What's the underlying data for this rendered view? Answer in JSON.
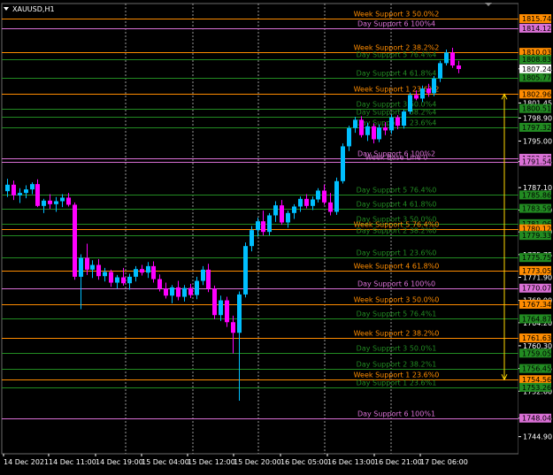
{
  "window": {
    "symbol_title": "XAUUSD,H1"
  },
  "colors": {
    "background": "#000000",
    "bull": "#00bfff",
    "bear": "#ff00ff",
    "orange_line": "#ff8c00",
    "violet_line": "#da70d6",
    "green_line": "#228b22",
    "axis_text": "#ffffff",
    "price_axis_bg": "#000000",
    "current_price_bg": "#ffffff",
    "range_marker": "#ffd700"
  },
  "chart_data": {
    "type": "candlestick",
    "timeframe": "H1",
    "ylim": [
      1742.0,
      1818.3
    ],
    "price_ticks": [
      "1807.24",
      "1801.45",
      "1798.90",
      "1795.00",
      "1791.54",
      "1787.10",
      "1783.30",
      "1779.60",
      "1775.75",
      "1771.90",
      "1768.00",
      "1764.20",
      "1760.30",
      "1756.45",
      "1752.60",
      "1748.04",
      "1744.90"
    ],
    "time_labels": [
      "14 Dec 2021",
      "14 Dec 11:00",
      "14 Dec 19:00",
      "15 Dec 04:00",
      "15 Dec 12:00",
      "15 Dec 20:00",
      "16 Dec 05:00",
      "16 Dec 13:00",
      "16 Dec 21:00",
      "17 Dec 06:00"
    ],
    "vertical_separators": [
      "14 Dec 11:00",
      "15 Dec 04:00",
      "15 Dec 20:00",
      "16 Dec 13:00",
      "17 Dec 06:00"
    ],
    "current_price": "1807.24",
    "range_marker": {
      "from": 1802.96,
      "to": 1754.56
    },
    "levels": [
      {
        "price": 1815.74,
        "label": "Week Support 3 50.0%2",
        "color": "orange",
        "tag": "1815.74"
      },
      {
        "price": 1814.12,
        "label": "Day Support 6 100%4",
        "color": "violet",
        "tag": "1814.12"
      },
      {
        "price": 1810.03,
        "label": "Week Support 2 38.2%2",
        "color": "orange",
        "tag": "1810.03"
      },
      {
        "price": 1808.83,
        "label": "Day Support 5 76.4%4",
        "color": "green",
        "tag": "1808.83"
      },
      {
        "price": 1805.77,
        "label": "Day Support 4 61.8%4",
        "color": "green",
        "tag": "1805.77"
      },
      {
        "price": 1802.96,
        "label": "Week Support 1 23.6%2",
        "color": "orange",
        "tag": "1802.96"
      },
      {
        "price": 1800.51,
        "label": "Day Support 3 50.0%4",
        "color": "green",
        "tag": "1800.51"
      },
      {
        "price": 1799.1,
        "label": "Day Support 2 38.2%4",
        "color": "green",
        "tag": ""
      },
      {
        "price": 1797.32,
        "label": "Day Support 1 23.6%4",
        "color": "green",
        "tag": "1797.32"
      },
      {
        "price": 1792.08,
        "label": "Day Support 6 100%2",
        "color": "violet",
        "tag": "1792.08"
      },
      {
        "price": 1791.54,
        "label": "Week Base Line 0",
        "color": "violet",
        "tag": "1791.54"
      },
      {
        "price": 1785.86,
        "label": "Day Support 5 76.4%0",
        "color": "green",
        "tag": "1785.86"
      },
      {
        "price": 1783.59,
        "label": "Day Support 4 61.8%0",
        "color": "green",
        "tag": "1783.59"
      },
      {
        "price": 1781.0,
        "label": "Day Support 3 50.0%0",
        "color": "green",
        "tag": "1781.06"
      },
      {
        "price": 1780.12,
        "label": "Week Support 5 76.4%0",
        "color": "orange",
        "tag": "1780.12"
      },
      {
        "price": 1779.0,
        "label": "Day Support 2 38.2%0",
        "color": "green",
        "tag": "1779.33"
      },
      {
        "price": 1775.25,
        "label": "Day Support 1 23.6%0",
        "color": "green",
        "tag": "1775.75"
      },
      {
        "price": 1773.05,
        "label": "Week Support 4 61.8%0",
        "color": "orange",
        "tag": "1773.05"
      },
      {
        "price": 1770.07,
        "label": "Day Support 6 100%0",
        "color": "violet",
        "tag": "1770.07"
      },
      {
        "price": 1767.34,
        "label": "Week Support 3 50.0%0",
        "color": "orange",
        "tag": "1767.34"
      },
      {
        "price": 1764.87,
        "label": "Day Support 5 76.4%1",
        "color": "green",
        "tag": "1764.87"
      },
      {
        "price": 1761.63,
        "label": "Week Support 2 38.2%0",
        "color": "orange",
        "tag": "1761.63"
      },
      {
        "price": 1759.05,
        "label": "Day Support 3 50.0%1",
        "color": "green",
        "tag": "1759.05"
      },
      {
        "price": 1756.45,
        "label": "Day Support 2 38.2%1",
        "color": "green",
        "tag": "1756.45"
      },
      {
        "price": 1754.56,
        "label": "Week Support 1 23.6%0",
        "color": "orange",
        "tag": "1754.56"
      },
      {
        "price": 1753.26,
        "label": "Day Support 1 23.6%1",
        "color": "green",
        "tag": "1753.26"
      },
      {
        "price": 1748.04,
        "label": "Day Support 6 100%1",
        "color": "violet",
        "tag": "1748.04"
      }
    ],
    "candles": [
      [
        1786.5,
        1788.6,
        1785.5,
        1787.6
      ],
      [
        1787.6,
        1788.3,
        1785.0,
        1785.8
      ],
      [
        1785.8,
        1787.0,
        1784.5,
        1786.2
      ],
      [
        1786.2,
        1787.5,
        1785.3,
        1786.8
      ],
      [
        1786.8,
        1788.0,
        1786.0,
        1787.7
      ],
      [
        1787.7,
        1788.5,
        1783.8,
        1784.0
      ],
      [
        1784.0,
        1785.2,
        1782.8,
        1784.9
      ],
      [
        1784.9,
        1786.0,
        1783.5,
        1784.3
      ],
      [
        1784.3,
        1785.5,
        1783.0,
        1784.8
      ],
      [
        1784.8,
        1786.0,
        1783.8,
        1785.4
      ],
      [
        1785.4,
        1786.2,
        1783.9,
        1784.2
      ],
      [
        1784.2,
        1784.6,
        1771.5,
        1772.0
      ],
      [
        1772.0,
        1775.8,
        1766.5,
        1775.2
      ],
      [
        1775.2,
        1777.6,
        1772.3,
        1773.2
      ],
      [
        1773.2,
        1774.8,
        1771.8,
        1774.0
      ],
      [
        1774.0,
        1775.0,
        1771.5,
        1772.1
      ],
      [
        1772.1,
        1773.5,
        1771.2,
        1772.8
      ],
      [
        1772.8,
        1773.2,
        1770.3,
        1771.0
      ],
      [
        1771.0,
        1772.3,
        1770.0,
        1771.9
      ],
      [
        1771.9,
        1773.5,
        1770.5,
        1770.9
      ],
      [
        1770.9,
        1772.5,
        1769.8,
        1772.0
      ],
      [
        1772.0,
        1773.8,
        1771.2,
        1773.3
      ],
      [
        1773.3,
        1774.0,
        1772.2,
        1772.7
      ],
      [
        1772.7,
        1774.5,
        1771.8,
        1773.8
      ],
      [
        1773.8,
        1774.6,
        1771.0,
        1771.6
      ],
      [
        1771.6,
        1772.4,
        1769.5,
        1770.0
      ],
      [
        1770.0,
        1771.0,
        1768.3,
        1768.8
      ],
      [
        1768.8,
        1770.6,
        1767.5,
        1770.2
      ],
      [
        1770.2,
        1771.3,
        1768.0,
        1768.6
      ],
      [
        1768.6,
        1770.6,
        1767.8,
        1770.1
      ],
      [
        1770.1,
        1770.8,
        1768.4,
        1768.9
      ],
      [
        1768.9,
        1772.0,
        1768.2,
        1771.3
      ],
      [
        1771.3,
        1773.8,
        1770.6,
        1773.2
      ],
      [
        1773.2,
        1774.2,
        1769.4,
        1770.0
      ],
      [
        1770.0,
        1770.5,
        1764.8,
        1765.5
      ],
      [
        1765.5,
        1768.8,
        1764.5,
        1768.0
      ],
      [
        1768.0,
        1768.6,
        1763.5,
        1764.3
      ],
      [
        1764.3,
        1765.4,
        1759.0,
        1762.5
      ],
      [
        1762.5,
        1769.5,
        1751.0,
        1769.0
      ],
      [
        1769.0,
        1777.8,
        1768.5,
        1777.2
      ],
      [
        1777.2,
        1780.6,
        1776.3,
        1779.9
      ],
      [
        1779.9,
        1782.0,
        1778.8,
        1781.4
      ],
      [
        1781.4,
        1783.2,
        1779.0,
        1779.6
      ],
      [
        1779.6,
        1782.8,
        1779.0,
        1782.4
      ],
      [
        1782.4,
        1784.8,
        1781.3,
        1784.1
      ],
      [
        1784.1,
        1785.0,
        1780.8,
        1781.2
      ],
      [
        1781.2,
        1783.2,
        1780.3,
        1782.8
      ],
      [
        1782.8,
        1784.3,
        1781.8,
        1783.9
      ],
      [
        1783.9,
        1785.6,
        1783.0,
        1785.2
      ],
      [
        1785.2,
        1786.0,
        1783.6,
        1784.0
      ],
      [
        1784.0,
        1785.6,
        1783.3,
        1785.1
      ],
      [
        1785.1,
        1787.0,
        1784.6,
        1786.6
      ],
      [
        1786.6,
        1787.6,
        1784.2,
        1784.6
      ],
      [
        1784.6,
        1786.2,
        1782.4,
        1783.0
      ],
      [
        1783.0,
        1788.8,
        1782.5,
        1788.2
      ],
      [
        1788.2,
        1794.6,
        1787.8,
        1794.1
      ],
      [
        1794.1,
        1797.6,
        1793.3,
        1797.2
      ],
      [
        1797.2,
        1799.1,
        1796.4,
        1798.6
      ],
      [
        1798.6,
        1799.2,
        1795.6,
        1796.0
      ],
      [
        1796.0,
        1798.1,
        1795.0,
        1797.5
      ],
      [
        1797.5,
        1798.0,
        1794.6,
        1795.3
      ],
      [
        1795.3,
        1797.8,
        1794.8,
        1797.3
      ],
      [
        1797.3,
        1798.2,
        1796.0,
        1796.8
      ],
      [
        1796.8,
        1799.5,
        1796.2,
        1799.0
      ],
      [
        1799.0,
        1799.4,
        1797.0,
        1797.6
      ],
      [
        1797.6,
        1800.3,
        1797.1,
        1800.0
      ],
      [
        1800.0,
        1803.2,
        1799.6,
        1802.8
      ],
      [
        1802.8,
        1803.6,
        1801.9,
        1802.2
      ],
      [
        1802.2,
        1804.4,
        1801.6,
        1803.9
      ],
      [
        1803.9,
        1804.7,
        1802.5,
        1803.1
      ],
      [
        1803.1,
        1806.0,
        1802.6,
        1805.6
      ],
      [
        1805.6,
        1808.6,
        1805.0,
        1808.2
      ],
      [
        1808.2,
        1810.5,
        1807.8,
        1810.0
      ],
      [
        1810.0,
        1810.8,
        1807.4,
        1807.8
      ],
      [
        1807.8,
        1808.6,
        1806.5,
        1807.2
      ]
    ]
  }
}
